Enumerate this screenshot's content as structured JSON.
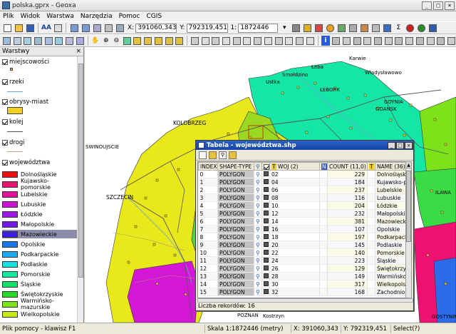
{
  "window": {
    "title": "polska.gprx - Geoxa"
  },
  "menu": [
    "Plik",
    "Widok",
    "Warstwa",
    "Narzędzia",
    "Pomoc",
    "CGIS"
  ],
  "toolbar": {
    "x_label": "X:",
    "x_value": "391060,343",
    "y_label": "Y:",
    "y_value": "792319,451",
    "scale_label": "1:",
    "scale_value": "1872446"
  },
  "layers": {
    "header": "Warstwy",
    "groups": [
      {
        "name": "miejscowości",
        "checked": true
      },
      {
        "name": "rzeki",
        "checked": true
      },
      {
        "name": "obrysy-miast",
        "checked": true
      },
      {
        "name": "kolej",
        "checked": true
      },
      {
        "name": "drogi",
        "checked": true
      },
      {
        "name": "województwa",
        "checked": true
      }
    ],
    "legend": [
      {
        "label": "Dolnośląskie",
        "color": "#ee1111"
      },
      {
        "label": "Kujawsko-pomorskie",
        "color": "#e81472"
      },
      {
        "label": "Lubelskie",
        "color": "#e0119a"
      },
      {
        "label": "Lubuskie",
        "color": "#cc14d6"
      },
      {
        "label": "Łódzkie",
        "color": "#9c19e8"
      },
      {
        "label": "Małopolskie",
        "color": "#7318e6"
      },
      {
        "label": "Mazowieckie",
        "color": "#3b1ee8",
        "selected": true
      },
      {
        "label": "Opolskie",
        "color": "#1976e8"
      },
      {
        "label": "Podkarpackie",
        "color": "#1ea8ee"
      },
      {
        "label": "Podlaskie",
        "color": "#16e0e0"
      },
      {
        "label": "Pomorskie",
        "color": "#13e6a0"
      },
      {
        "label": "Śląskie",
        "color": "#15e06b"
      },
      {
        "label": "Świętokrzyskie",
        "color": "#2ad82a"
      },
      {
        "label": "Warmińsko-mazurskie",
        "color": "#7ee21a"
      },
      {
        "label": "Wielkopolskie",
        "color": "#c8e81a"
      }
    ]
  },
  "map": {
    "labels": [
      "Karwie",
      "Łeba",
      "Władysławowo",
      "Smołdzino",
      "Ustka",
      "ŁEBORK",
      "GDYNIA",
      "GDANSK",
      "KOLOBRZEG",
      "SWINOUJSCIE",
      "SZCZECIN",
      "ILAWA",
      "POZNAN",
      "Kostrzyn",
      "GOSTYNIN"
    ]
  },
  "table": {
    "title": "Tabela - województwa.shp",
    "columns": [
      "INDEX",
      "SHAPE-TYPE",
      "",
      "",
      "WOJ (2)",
      "",
      "COUNT (11,0)",
      "",
      "NAME (36)"
    ],
    "rows": [
      {
        "index": "0",
        "shape": "POLYGON",
        "woj": "02",
        "count": "229",
        "name": "Dolnośląskie"
      },
      {
        "index": "1",
        "shape": "POLYGON",
        "woj": "04",
        "count": "184",
        "name": "Kujawsko-pomorskie"
      },
      {
        "index": "2",
        "shape": "POLYGON",
        "woj": "06",
        "count": "237",
        "name": "Lubelskie"
      },
      {
        "index": "3",
        "shape": "POLYGON",
        "woj": "08",
        "count": "116",
        "name": "Lubuskie"
      },
      {
        "index": "4",
        "shape": "POLYGON",
        "woj": "10",
        "count": "204",
        "name": "Łódzkie"
      },
      {
        "index": "5",
        "shape": "POLYGON",
        "woj": "12",
        "count": "232",
        "name": "Małopolskie"
      },
      {
        "index": "6",
        "shape": "POLYGON",
        "woj": "14",
        "count": "381",
        "name": "Mazowieckie"
      },
      {
        "index": "7",
        "shape": "POLYGON",
        "woj": "16",
        "count": "107",
        "name": "Opolskie"
      },
      {
        "index": "8",
        "shape": "POLYGON",
        "woj": "18",
        "count": "197",
        "name": "Podkarpackie"
      },
      {
        "index": "9",
        "shape": "POLYGON",
        "woj": "20",
        "count": "145",
        "name": "Podlaskie"
      },
      {
        "index": "10",
        "shape": "POLYGON",
        "woj": "22",
        "count": "140",
        "name": "Pomorskie"
      },
      {
        "index": "11",
        "shape": "POLYGON",
        "woj": "24",
        "count": "223",
        "name": "Śląskie"
      },
      {
        "index": "12",
        "shape": "POLYGON",
        "woj": "26",
        "count": "129",
        "name": "Świętokrzyskie"
      },
      {
        "index": "13",
        "shape": "POLYGON",
        "woj": "28",
        "count": "149",
        "name": "Warmińsko-mazurskie"
      },
      {
        "index": "14",
        "shape": "POLYGON",
        "woj": "30",
        "count": "317",
        "name": "Wielkopolskie"
      },
      {
        "index": "15",
        "shape": "POLYGON",
        "woj": "32",
        "count": "168",
        "name": "Zachodnio-pomorskie"
      }
    ],
    "record_count": "Liczba rekordów: 16"
  },
  "status": {
    "help": "Plik pomocy - klawisz F1",
    "scale": "Skala 1:1872446 (metry)",
    "x": "X: 391060,343",
    "y": "Y: 792319,451",
    "select": "Select(?)"
  }
}
